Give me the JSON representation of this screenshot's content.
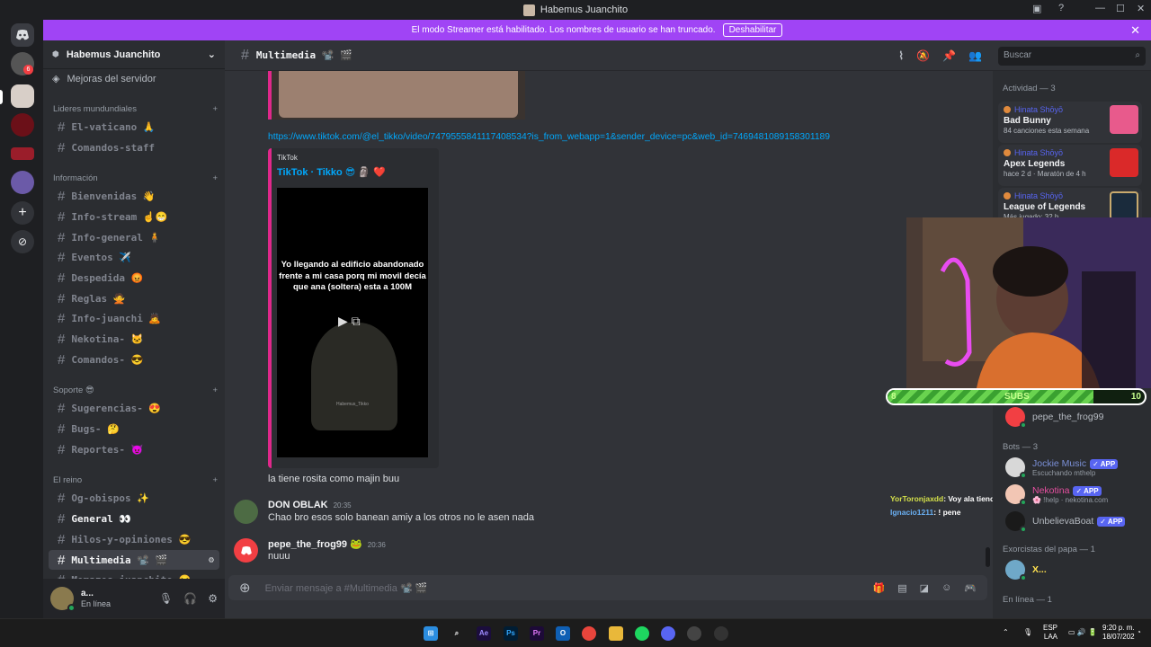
{
  "window": {
    "title": "Habemus Juanchito",
    "controls": [
      "—",
      "☐",
      "✕"
    ]
  },
  "streamer_banner": {
    "text": "El modo Streamer está habilitado. Los nombres de usuario se han truncado.",
    "button": "Deshabilitar"
  },
  "guilds": {
    "badge": "6"
  },
  "server": {
    "name": "Habemus Juanchito",
    "boost": "Mejoras del servidor"
  },
  "categories": [
    {
      "name": "Lideres mundundiales",
      "channels": [
        "El-vaticano 🙏",
        "Comandos-staff"
      ]
    },
    {
      "name": "Información",
      "channels": [
        "Bienvenidas 👋",
        "Info-stream ☝️😁",
        "Info-general 🧍",
        "Eventos ✈️",
        "Despedida 😡",
        "Reglas 🙅",
        "Info-juanchi 🙇",
        "Nekotina- 🐱",
        "Comandos- 😎"
      ]
    },
    {
      "name": "Soporte 😎",
      "channels": [
        "Sugerencias- 😍",
        "Bugs- 🤔",
        "Reportes- 😈"
      ]
    },
    {
      "name": "El reino",
      "channels": [
        "Og-obispos ✨",
        "General 👀",
        "Hilos-y-opiniones 😎",
        "Multimedia 📽️ 🎬",
        "Momazos-juanchito 😝"
      ]
    }
  ],
  "user_panel": {
    "name": "a...",
    "status": "En línea"
  },
  "channel_header": {
    "name": "Multimedia 📽️ 🎬"
  },
  "search": {
    "placeholder": "Buscar"
  },
  "chat": {
    "link": "https://www.tiktok.com/@el_tikko/video/7479555841117408534?is_from_webapp=1&sender_device=pc&web_id=7469481089158301189",
    "embed": {
      "provider": "TikTok",
      "title": "TikTok · Tikko 😎 🗿 ❤️",
      "caption": [
        "Yo llegando al edificio abandonado",
        "frente a mi casa porq mi movil decía",
        "que ana (soltera) esta a 100M"
      ],
      "watermark": "Habemus_Tikko"
    },
    "messages": [
      {
        "author": "",
        "time": "",
        "text": "la tiene rosita como majin buu"
      },
      {
        "author": "DON OBLAK",
        "time": "20:35",
        "text": "Chao bro  esos solo banean amiy a  los otros no le asen nada"
      },
      {
        "author": "pepe_the_frog99 🐸",
        "time": "20:36",
        "text": "nuuu"
      }
    ],
    "composer_placeholder": "Enviar mensaje a #Multimedia 📽️ 🎬"
  },
  "stream_chat": [
    {
      "user": "YorToronjaxdd",
      "text": ": Voy ala tienda"
    },
    {
      "user": "Ignacio1211",
      "text": ": ! pene"
    }
  ],
  "members": {
    "activity_header": "Actividad — 3",
    "activities": [
      {
        "user": "Hinata Shōyō",
        "game": "Bad Bunny",
        "sub": "84 canciones esta semana"
      },
      {
        "user": "Hinata Shōyō",
        "game": "Apex Legends",
        "sub": "hace 2 d  ·  Maratón de 4 h"
      },
      {
        "user": "Hinata Shōyō",
        "game": "League of Legends",
        "sub": "Más jugado: 32 h"
      }
    ],
    "online_member": "pepe_the_frog99",
    "bots_header": "Bots — 3",
    "bots": [
      {
        "name": "Jockie Music",
        "sub": "Escuchando mthelp",
        "badge": "✓ APP"
      },
      {
        "name": "Nekotina",
        "sub": "🌸 !help · nekotina.com",
        "badge": "✓ APP"
      },
      {
        "name": "UnbelievaBoat",
        "sub": "",
        "badge": "✓ APP"
      }
    ],
    "exorcists_header": "Exorcistas del papa — 1",
    "exorcist": "X...",
    "online_header": "En línea — 1"
  },
  "subs_goal": {
    "current": "8",
    "label": "SUBS",
    "target": "10",
    "progress": 0.8
  },
  "taskbar": {
    "lang": "ESP",
    "layout": "LAA",
    "time": "9:20 p. m.",
    "date": "18/07/202"
  },
  "colors": {
    "accent": "#5865f2",
    "streamer": "#a044f5",
    "online": "#23a55a",
    "embed_border": "#e0288b"
  }
}
